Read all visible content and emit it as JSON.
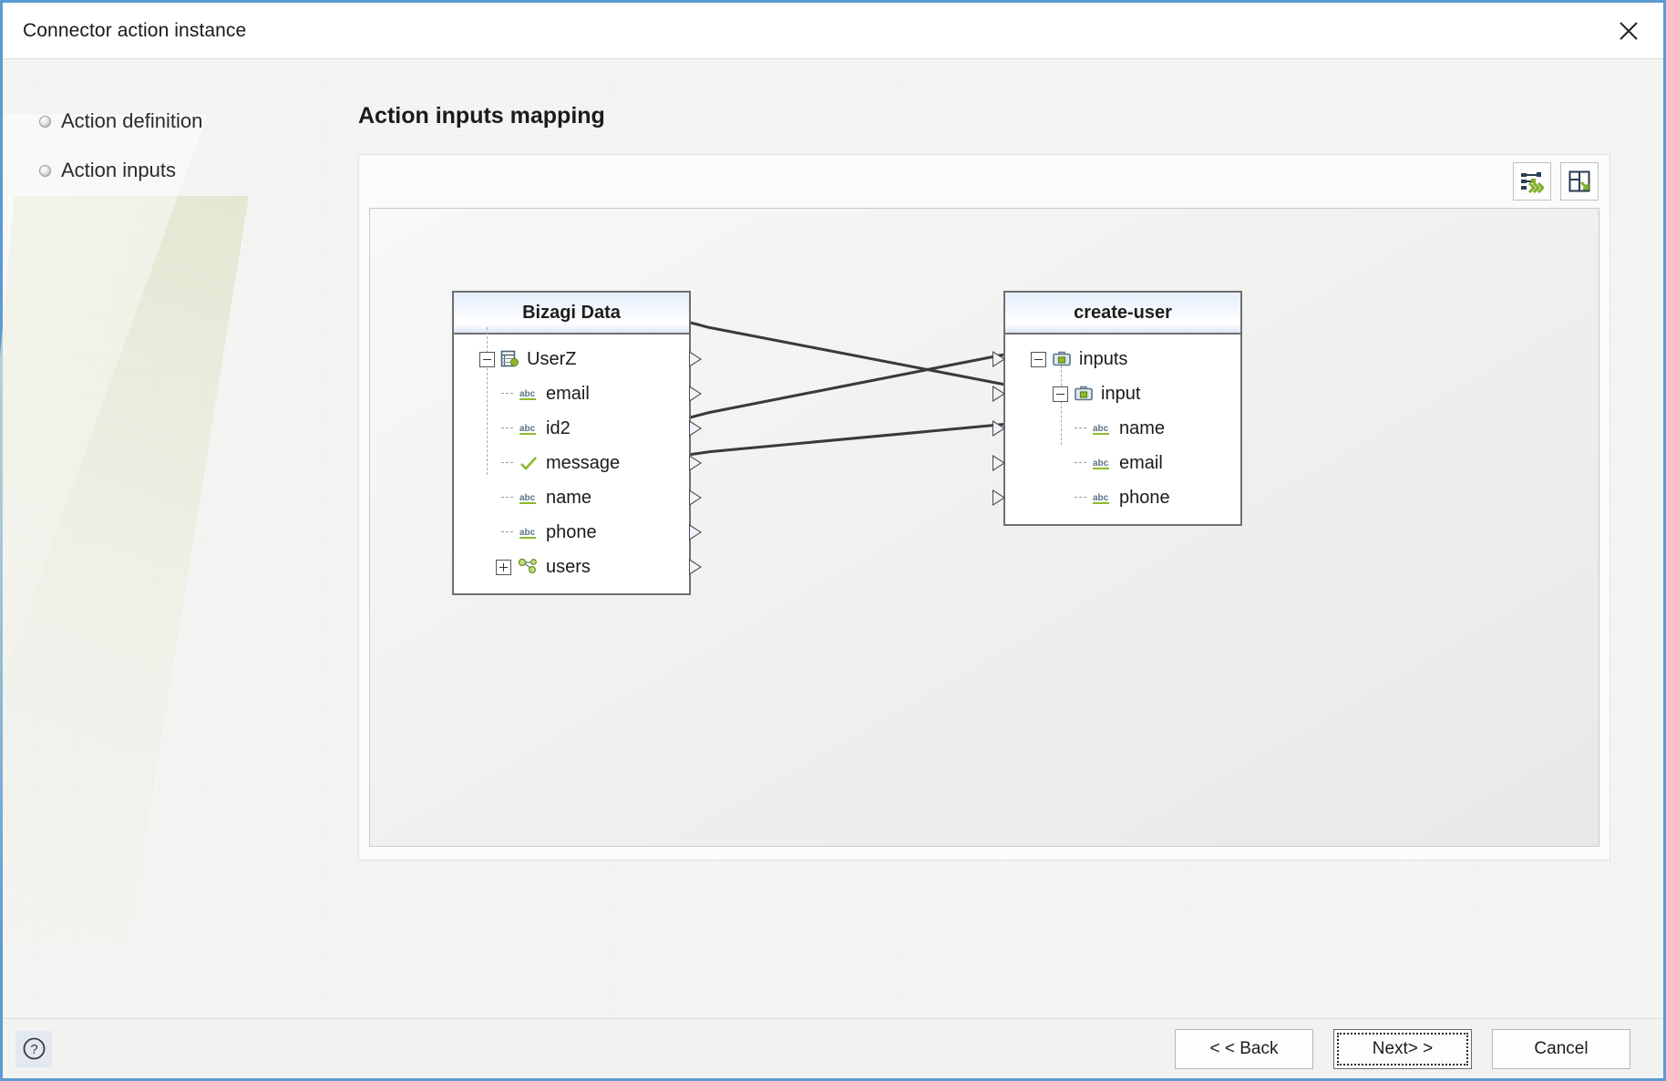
{
  "window": {
    "title": "Connector action instance",
    "close_icon": "close-icon",
    "accent": "#5b9bd0"
  },
  "steps": {
    "items": [
      {
        "label": "Action definition",
        "bullet_icon": "step-bullet-icon"
      },
      {
        "label": "Action inputs",
        "bullet_icon": "step-bullet-icon"
      }
    ]
  },
  "pane": {
    "title": "Action inputs mapping",
    "toolbar": {
      "buttons": [
        {
          "name": "auto-map-button",
          "icon": "auto-map-icon",
          "tooltip": "Auto map"
        },
        {
          "name": "fit-layout-button",
          "icon": "fit-layout-icon",
          "tooltip": "Fit layout"
        }
      ]
    }
  },
  "mapping": {
    "source": {
      "title": "Bizagi Data",
      "nodes": [
        {
          "label": "UserZ",
          "icon": "entity-icon",
          "indent": 0,
          "expander": "minus",
          "port": true
        },
        {
          "label": "email",
          "icon": "abc-string-icon",
          "indent": 1,
          "expander": "none",
          "port": true
        },
        {
          "label": "id2",
          "icon": "abc-string-icon",
          "indent": 1,
          "expander": "none",
          "port": true
        },
        {
          "label": "message",
          "icon": "check-bool-icon",
          "indent": 1,
          "expander": "none",
          "port": true
        },
        {
          "label": "name",
          "icon": "abc-string-icon",
          "indent": 1,
          "expander": "none",
          "port": true
        },
        {
          "label": "phone",
          "icon": "abc-string-icon",
          "indent": 1,
          "expander": "none",
          "port": true
        },
        {
          "label": "users",
          "icon": "collection-icon",
          "indent": 1,
          "expander": "plus",
          "port": true
        }
      ]
    },
    "target": {
      "title": "create-user",
      "nodes": [
        {
          "label": "inputs",
          "icon": "briefcase-icon",
          "indent": 0,
          "expander": "minus",
          "port": true
        },
        {
          "label": "input",
          "icon": "briefcase-icon",
          "indent": 1,
          "expander": "minus",
          "port": true
        },
        {
          "label": "name",
          "icon": "abc-string-icon",
          "indent": 2,
          "expander": "none",
          "port": true
        },
        {
          "label": "email",
          "icon": "abc-string-icon",
          "indent": 2,
          "expander": "none",
          "port": true
        },
        {
          "label": "phone",
          "icon": "abc-string-icon",
          "indent": 2,
          "expander": "none",
          "port": true
        }
      ]
    },
    "links": [
      {
        "from": "email",
        "to": "email"
      },
      {
        "from": "name",
        "to": "name"
      },
      {
        "from": "phone",
        "to": "phone"
      }
    ],
    "link_color": "#3a3a3a"
  },
  "footer": {
    "help_icon": "help-question-icon",
    "buttons": [
      {
        "name": "back-button",
        "label": "< < Back",
        "focused": false
      },
      {
        "name": "next-button",
        "label": "Next> >",
        "focused": true
      },
      {
        "name": "cancel-button",
        "label": "Cancel",
        "focused": false
      }
    ]
  }
}
